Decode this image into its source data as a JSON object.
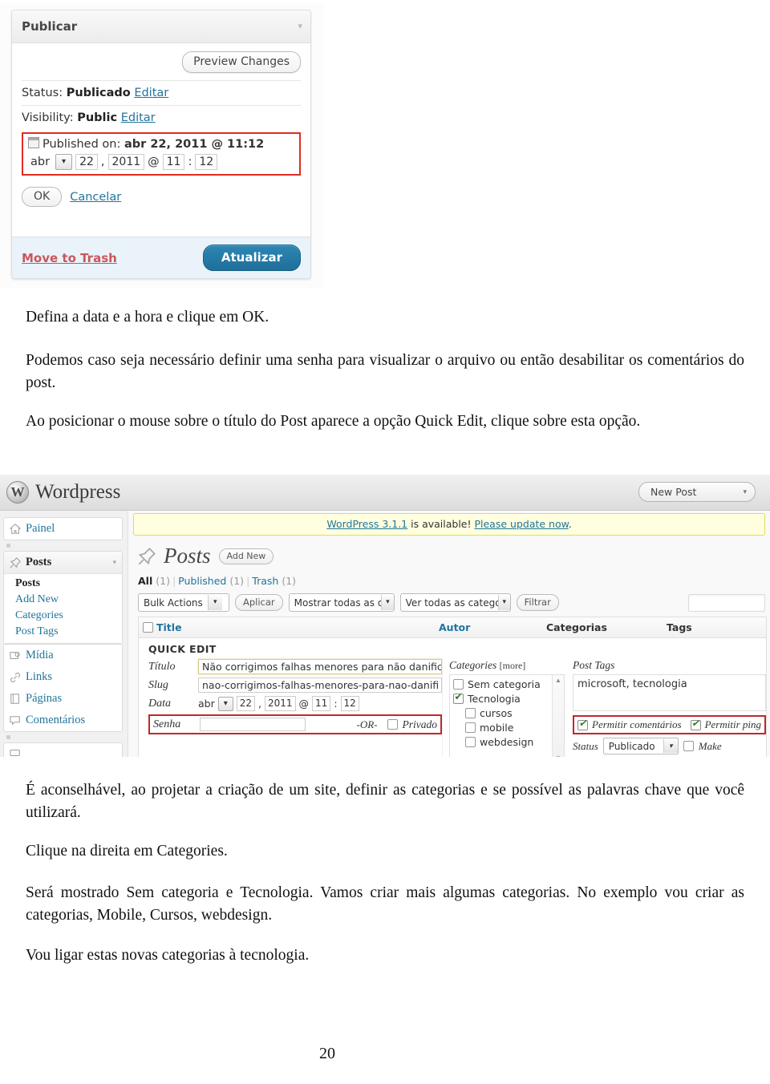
{
  "page_number": "20",
  "screenshot_publicar": {
    "panel_title": "Publicar",
    "toggle_icon": "▾",
    "preview_button": "Preview Changes",
    "status_label": "Status:",
    "status_value": "Publicado",
    "status_edit": "Editar",
    "visibility_label": "Visibility:",
    "visibility_value": "Public",
    "visibility_edit": "Editar",
    "published_on_label": "Published on:",
    "published_on_value": "abr 22, 2011 @ 11:12",
    "date_month": "abr",
    "date_month_arrow": "▾",
    "date_day": "22",
    "date_comma": ",",
    "date_year": "2011",
    "date_at": "@",
    "date_hour": "11",
    "date_colon": ":",
    "date_minute": "12",
    "ok_button": "OK",
    "cancel_link": "Cancelar",
    "trash_link": "Move to Trash",
    "update_button": "Atualizar",
    "highlight_color": "#e02b20",
    "primary_color": "#1f6f9a",
    "link_color": "#21759b"
  },
  "body_text": {
    "p1": "Defina a data e a hora e clique em OK.",
    "p2": "Podemos caso seja necessário definir uma senha para visualizar o arquivo ou então desabilitar os comentários do post.",
    "p3": "Ao posicionar o mouse sobre o título do Post aparece a opção Quick Edit, clique sobre esta opção.",
    "p4": "É aconselhável, ao projetar a criação de um site, definir as categorias e se possível as palavras chave que você utilizará.",
    "p5": "Clique na direita em Categories.",
    "p6": "Será mostrado Sem categoria e Tecnologia. Vamos criar mais algumas categorias. No exemplo vou criar as categorias, Mobile, Cursos, webdesign.",
    "p7": "Vou ligar estas novas categorias à tecnologia."
  },
  "screenshot_wordpress": {
    "topbar": {
      "logo_text": "Wordpress",
      "logo_mark": "W",
      "new_post_button": "New Post",
      "new_post_arrow": "▾"
    },
    "sidebar": {
      "dashboard": {
        "label": "Painel",
        "icon": "home-icon"
      },
      "posts": {
        "label": "Posts",
        "icon": "pin-icon",
        "arrow": "▾",
        "submenu": [
          "Posts",
          "Add New",
          "Categories",
          "Post Tags"
        ],
        "active_submenu": "Posts"
      },
      "items": [
        {
          "label": "Mídia",
          "icon": "media-icon"
        },
        {
          "label": "Links",
          "icon": "link-icon"
        },
        {
          "label": "Páginas",
          "icon": "page-icon"
        },
        {
          "label": "Comentários",
          "icon": "comment-icon"
        }
      ]
    },
    "notice": {
      "link1": "WordPress 3.1.1",
      "middle": " is available! ",
      "link2": "Please update now",
      "tail": "."
    },
    "page_title": "Posts",
    "add_new_button": "Add New",
    "status_filters": [
      {
        "label": "All",
        "count": "(1)",
        "active": true
      },
      {
        "label": "Published",
        "count": "(1)",
        "active": false
      },
      {
        "label": "Trash",
        "count": "(1)",
        "active": false
      }
    ],
    "tablenav": {
      "bulk_actions": "Bulk Actions",
      "apply_button": "Aplicar",
      "date_filter": "Mostrar todas as da",
      "category_filter": "Ver todas as categoria",
      "filter_button": "Filtrar",
      "search_value": ""
    },
    "table_headers": [
      "Title",
      "Autor",
      "Categorias",
      "Tags"
    ],
    "quick_edit": {
      "heading": "QUICK EDIT",
      "fields": {
        "title_label": "Título",
        "title_value": "Não corrigimos falhas menores para não danific",
        "slug_label": "Slug",
        "slug_value": "nao-corrigimos-falhas-menores-para-nao-danifi",
        "date_label": "Data",
        "date_month": "abr",
        "date_month_arrow": "▾",
        "date_day": "22",
        "date_comma": ",",
        "date_year": "2011",
        "date_at": "@",
        "date_hour": "11",
        "date_colon": ":",
        "date_minute": "12",
        "password_label": "Senha",
        "password_value": "",
        "or_separator": "-OR-",
        "private_label": "Privado",
        "private_checked": false
      },
      "categories": {
        "label": "Categories",
        "more": "[more]",
        "items": [
          {
            "label": "Sem categoria",
            "checked": false,
            "indent": false
          },
          {
            "label": "Tecnologia",
            "checked": true,
            "indent": false
          },
          {
            "label": "cursos",
            "checked": false,
            "indent": true
          },
          {
            "label": "mobile",
            "checked": false,
            "indent": true
          },
          {
            "label": "webdesign",
            "checked": false,
            "indent": true
          }
        ],
        "scroll_up": "▲",
        "scroll_down": "▼"
      },
      "tags": {
        "label": "Post Tags",
        "value": "microsoft, tecnologia"
      },
      "allow_comments_label": "Permitir comentários",
      "allow_comments_checked": true,
      "allow_pings_label": "Permitir ping",
      "allow_pings_checked": true,
      "status_label": "Status",
      "status_value": "Publicado",
      "status_arrow": "▾",
      "sticky_label": "Make",
      "sticky_checked": false
    },
    "highlight_color": "#c1272d",
    "link_color": "#21759b",
    "notice_bg": "#ffffe0"
  }
}
